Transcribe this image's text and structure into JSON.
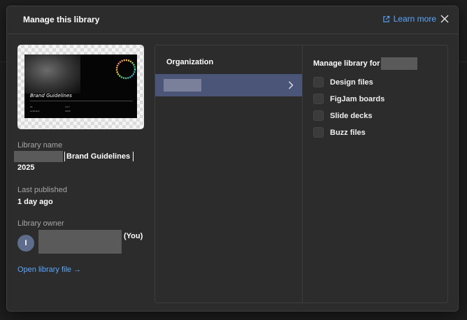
{
  "header": {
    "title": "Manage this library",
    "learn_more": "Learn more"
  },
  "thumbnail": {
    "title": "Brand Guidelines",
    "ring_text": "FULL CIRCLE FUTURE GROWING",
    "footer_left_1": "01",
    "footer_left_2": "Le Brand",
    "footer_mid_1": "1/77",
    "footer_mid_2": "2025"
  },
  "library_name": {
    "label": "Library name",
    "value_mid": "Brand Guidelines",
    "value_end": "2025"
  },
  "last_published": {
    "label": "Last published",
    "value": "1 day ago"
  },
  "owner": {
    "label": "Library owner",
    "avatar_initial": "I",
    "suffix": "(You)"
  },
  "open_link": "Open library file →",
  "organization": {
    "heading": "Organization"
  },
  "manage": {
    "heading": "Manage library for",
    "options": [
      {
        "label": "Design files",
        "checked": false
      },
      {
        "label": "FigJam boards",
        "checked": false
      },
      {
        "label": "Slide decks",
        "checked": false
      },
      {
        "label": "Buzz files",
        "checked": false
      }
    ]
  },
  "colors": {
    "modal_bg": "#2c2c2c",
    "accent_link": "#5aa7ff",
    "selected_row": "#4a5578",
    "avatar": "#5f6d8c"
  }
}
